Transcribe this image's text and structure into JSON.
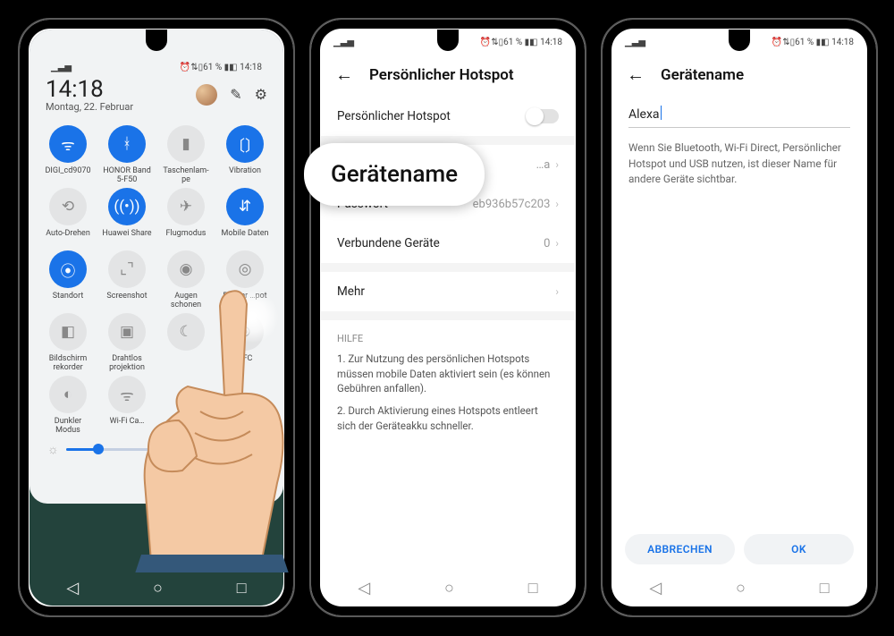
{
  "status": {
    "signal": "▁▃▅",
    "right": "⏰⇅▯61 % ▮◧ 14:18"
  },
  "nav": {
    "back": "◁",
    "home": "○",
    "recent": "□"
  },
  "phone1": {
    "time": "14:18",
    "date": "Montag, 22. Februar",
    "tiles": [
      {
        "icon": "wifi",
        "on": true,
        "label": "DIGI_cd9070"
      },
      {
        "icon": "bt",
        "on": true,
        "label": "HONOR Band 5-F50"
      },
      {
        "icon": "torch",
        "on": false,
        "label": "Taschenlam-pe"
      },
      {
        "icon": "vibrate",
        "on": true,
        "label": "Vibration"
      },
      {
        "icon": "rotate",
        "on": false,
        "label": "Auto-Drehen"
      },
      {
        "icon": "hshare",
        "on": true,
        "label": "Huawei Share"
      },
      {
        "icon": "plane",
        "on": false,
        "label": "Flugmodus"
      },
      {
        "icon": "data",
        "on": true,
        "label": "Mobile Daten"
      },
      {
        "icon": "pin",
        "on": true,
        "label": "Standort"
      },
      {
        "icon": "sshot",
        "on": false,
        "label": "Screenshot"
      },
      {
        "icon": "eye",
        "on": false,
        "label": "Augen schonen"
      },
      {
        "icon": "hotspot",
        "on": false,
        "label": "P…cher …pot"
      },
      {
        "icon": "rec",
        "on": false,
        "label": "Bildschirm rekorder"
      },
      {
        "icon": "cast",
        "on": false,
        "label": "Drahtlos projektion"
      },
      {
        "icon": "moon",
        "on": false,
        "label": ""
      },
      {
        "icon": "nfc",
        "on": false,
        "label": "…FC"
      },
      {
        "icon": "dark",
        "on": false,
        "label": "Dunkler Modus"
      },
      {
        "icon": "wifi2",
        "on": false,
        "label": "Wi-Fi Ca…"
      }
    ]
  },
  "phone2": {
    "title": "Persönlicher Hotspot",
    "toggle_label": "Persönlicher Hotspot",
    "geraetename_label": "Gerätename",
    "geraetename_val": "…a",
    "passwort_label": "Passwort",
    "passwort_val": "eb936b57c203",
    "verbundene_label": "Verbundene Geräte",
    "verbundene_val": "0",
    "mehr": "Mehr",
    "hilfe": "HILFE",
    "help1": "1. Zur Nutzung des persönlichen Hotspots müssen mobile Daten aktiviert sein (es können Gebühren anfallen).",
    "help2": "2. Durch Aktivierung eines Hotspots entleert sich der Geräteakku schneller."
  },
  "callout": "Gerätename",
  "phone3": {
    "title": "Gerätename",
    "input": "Alexa",
    "desc": "Wenn Sie Bluetooth, Wi-Fi Direct, Persönlicher Hotspot und USB nutzen, ist dieser Name für andere Geräte sichtbar.",
    "cancel": "ABBRECHEN",
    "ok": "OK"
  },
  "icons": {
    "wifi": "ᯤ",
    "bt": "ᚼ",
    "torch": "▮",
    "vibrate": "〔〕",
    "rotate": "⟲",
    "hshare": "((•))",
    "plane": "✈",
    "data": "⇵",
    "pin": "⦿",
    "sshot": "⌞⌝",
    "eye": "◉",
    "hotspot": "◎",
    "rec": "◧",
    "cast": "▣",
    "moon": "☾",
    "nfc": "⊚",
    "dark": "◐",
    "wifi2": "ᯤ"
  }
}
